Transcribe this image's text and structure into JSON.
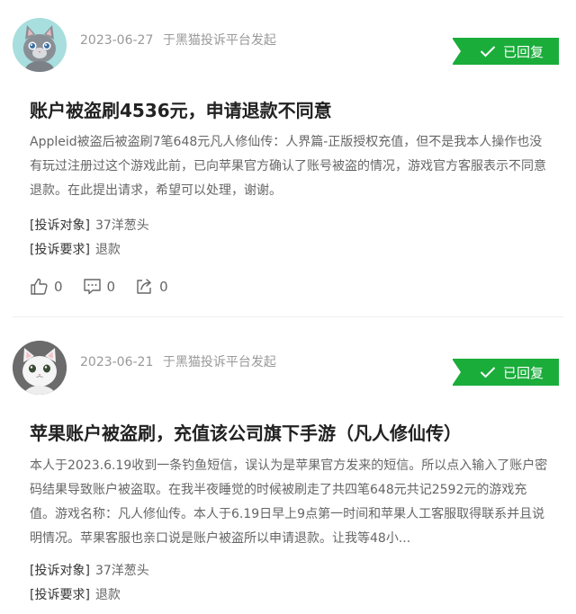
{
  "complaints": [
    {
      "date": "2023-06-27",
      "source": "于黑猫投诉平台发起",
      "status": "已回复",
      "title": "账户被盗刷4536元，申请退款不同意",
      "body": "Appleid被盗后被盗刷7笔648元凡人修仙传：人界篇-正版授权充值，但不是我本人操作也没有玩过注册过这个游戏此前，已向苹果官方确认了账号被盗的情况，游戏官方客服表示不同意退款。在此提出请求，希望可以处理，谢谢。",
      "target_key": "[投诉对象]",
      "target_value": "37洋葱头",
      "demand_key": "[投诉要求]",
      "demand_value": "退款",
      "likes": "0",
      "comments": "0",
      "shares": "0"
    },
    {
      "date": "2023-06-21",
      "source": "于黑猫投诉平台发起",
      "status": "已回复",
      "title": "苹果账户被盗刷，充值该公司旗下手游（凡人修仙传）",
      "body": "本人于2023.6.19收到一条钓鱼短信，误认为是苹果官方发来的短信。所以点入输入了账户密码结果导致账户被盗取。在我半夜睡觉的时候被刷走了共四笔648元共记2592元的游戏充值。游戏名称：凡人修仙传。本人于6.19日早上9点第一时间和苹果人工客服取得联系并且说明情况。苹果客服也亲口说是账户被盗所以申请退款。让我等48小...",
      "target_key": "[投诉对象]",
      "target_value": "37洋葱头",
      "demand_key": "[投诉要求]",
      "demand_value": "退款"
    }
  ],
  "colors": {
    "status_badge": "#1aad3a",
    "meta_text": "#999999",
    "title_text": "#222222"
  }
}
